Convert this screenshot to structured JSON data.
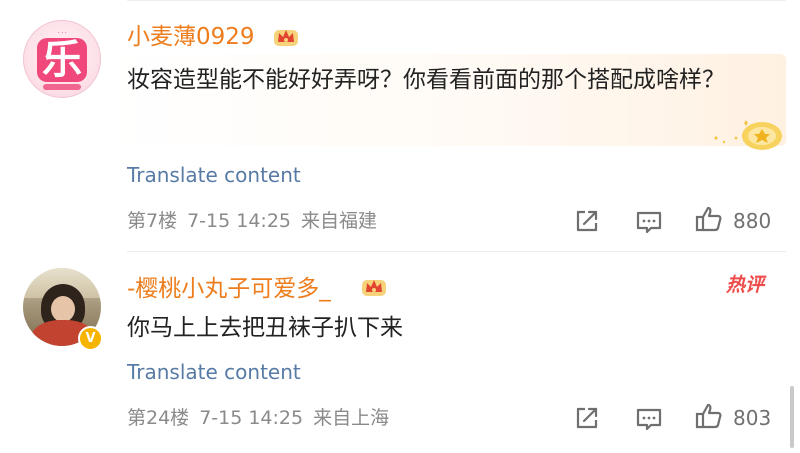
{
  "colors": {
    "username": "#ed7d1d",
    "translate_link": "#587ba5",
    "meta_text": "#8a8a8a",
    "hot_tag": "#ee4b4b",
    "vip_badge": "#f6b400"
  },
  "comments": [
    {
      "username": "小麦薄0929",
      "avatar_icon": "pink-le-avatar",
      "avatar_glyph": "乐",
      "badge_icon": "crown-icon",
      "text": "妆容造型能不能好好弄呀？你看看前面的那个搭配成啥样？",
      "decoration_icon": "gem-badge-icon",
      "translate_label": "Translate content",
      "floor": "第7楼",
      "date": "7-15 14:25",
      "location": "来自福建",
      "likes": "880"
    },
    {
      "username": "-樱桃小丸子可爱多_",
      "avatar_icon": "photo-avatar",
      "verified_mark": "V",
      "badge_icon": "crown-icon",
      "text": "你马上上去把丑袜子扒下来",
      "hot_tag": "热评",
      "translate_label": "Translate content",
      "floor": "第24楼",
      "date": "7-15 14:25",
      "location": "来自上海",
      "likes": "803"
    }
  ]
}
